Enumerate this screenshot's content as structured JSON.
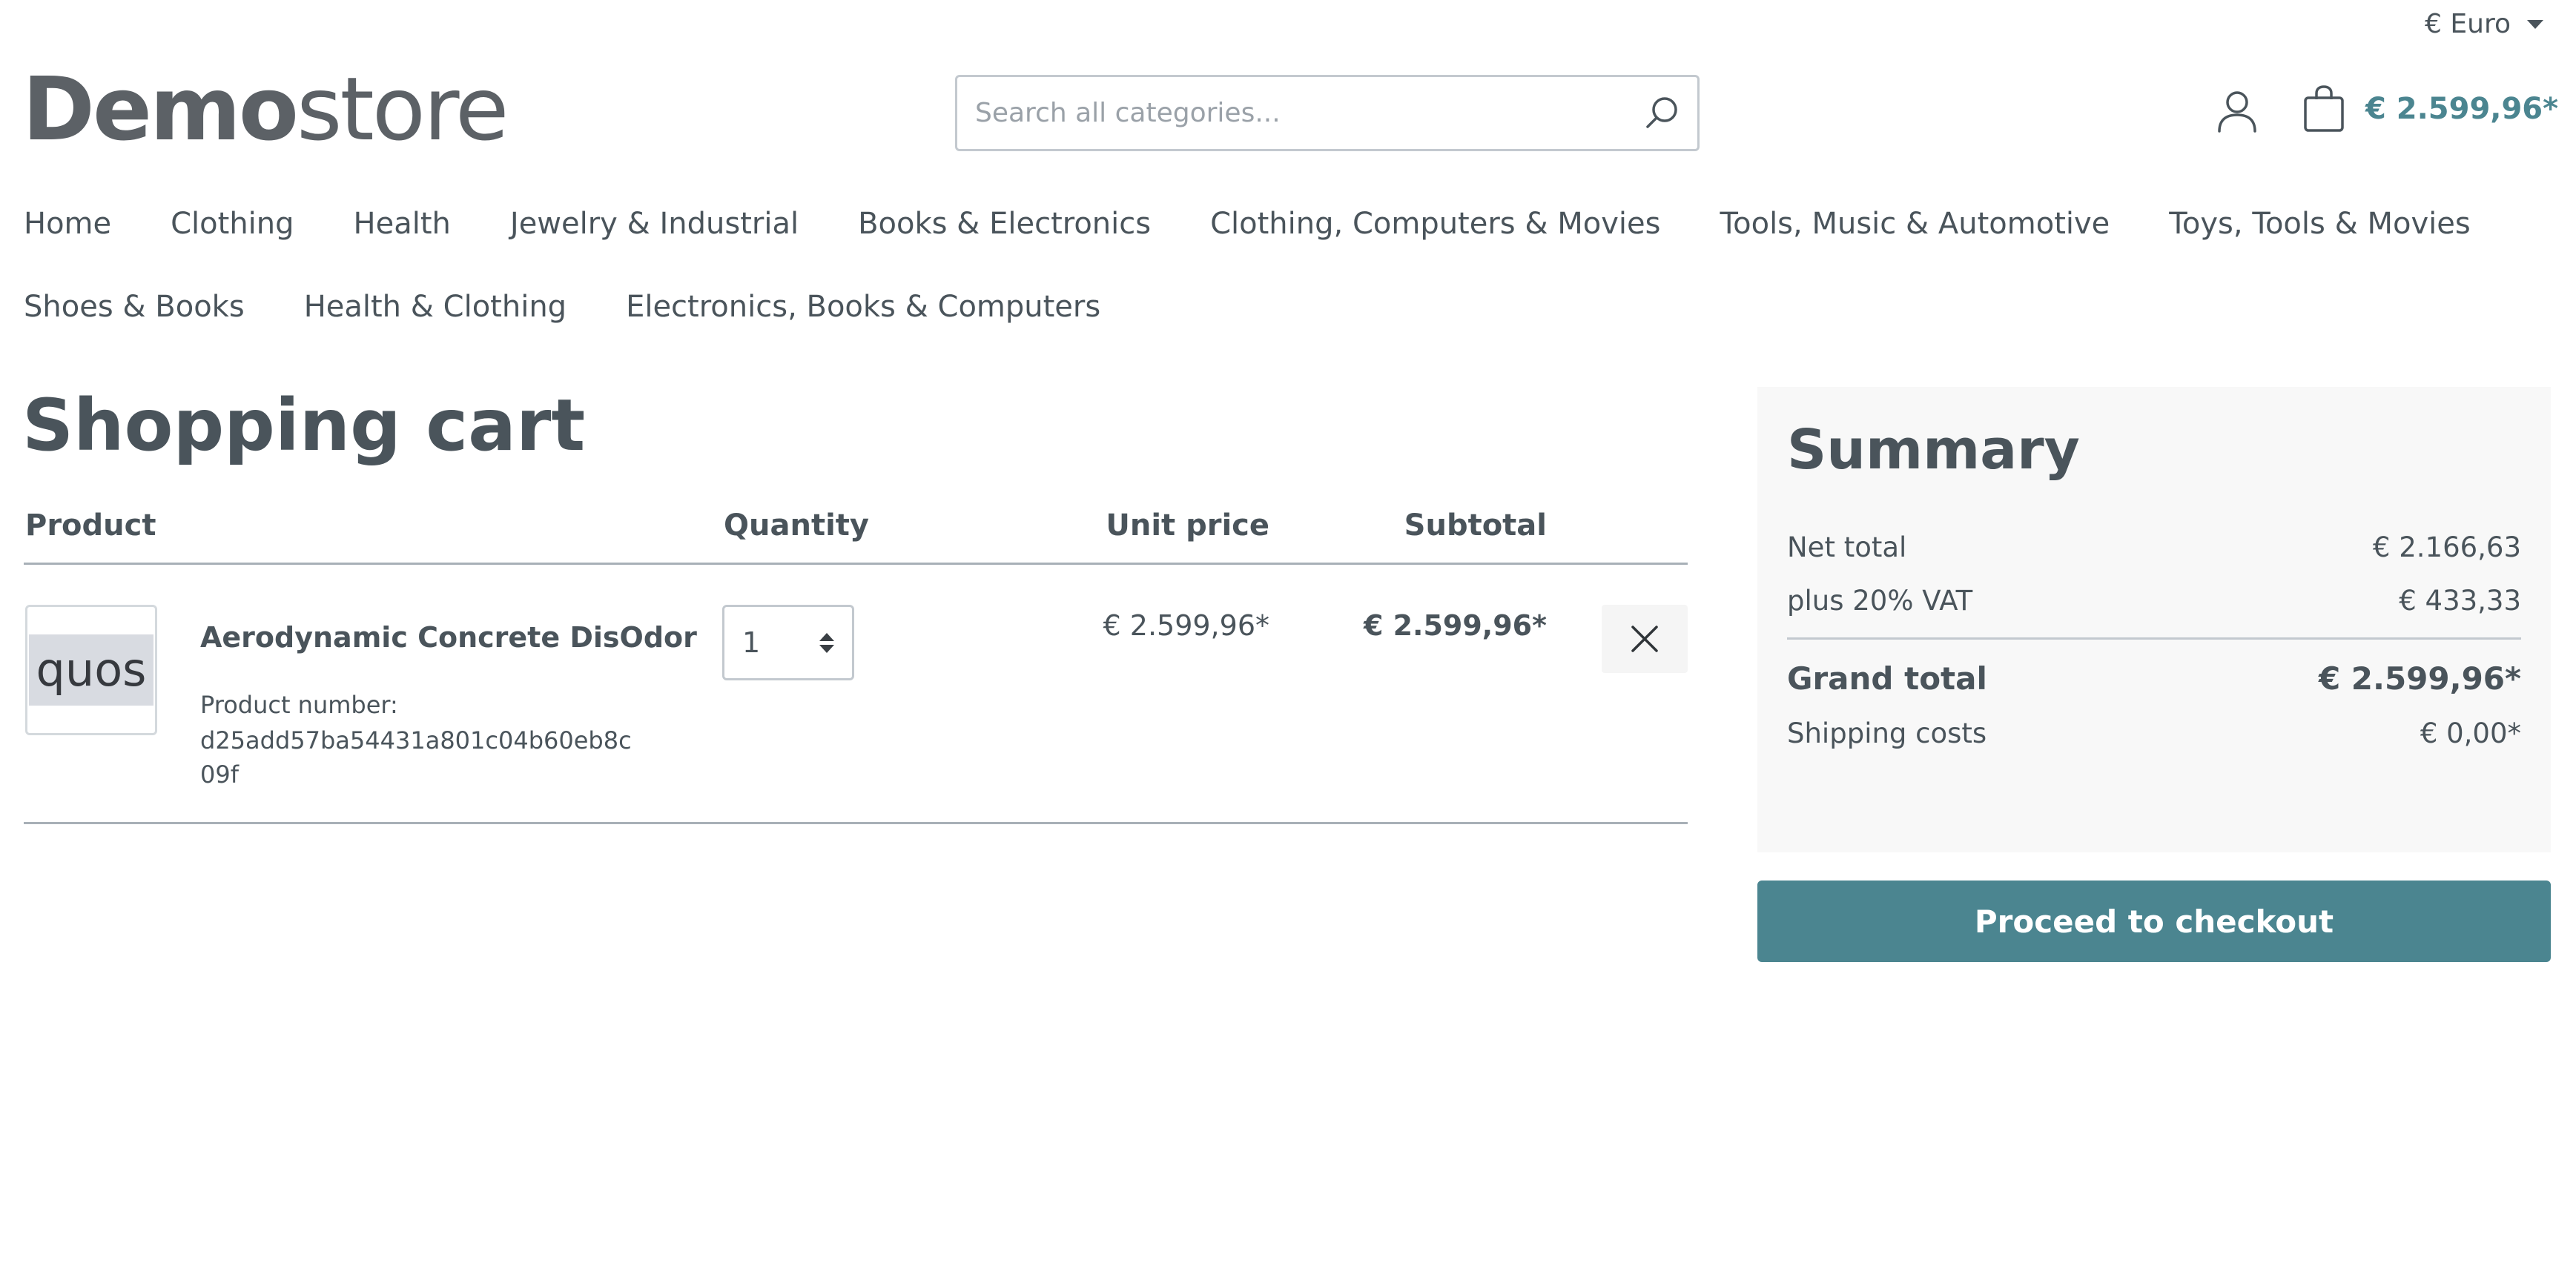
{
  "currency": {
    "label": "€ Euro"
  },
  "header": {
    "logo_strong": "Demo",
    "logo_light": "store",
    "search_placeholder": "Search all categories...",
    "cart_total": "€ 2.599,96*"
  },
  "nav": {
    "items": [
      "Home",
      "Clothing",
      "Health",
      "Jewelry & Industrial",
      "Books & Electronics",
      "Clothing, Computers & Movies",
      "Tools, Music & Automotive",
      "Toys, Tools & Movies",
      "Shoes & Books",
      "Health & Clothing",
      "Electronics, Books & Computers"
    ]
  },
  "page": {
    "title": "Shopping cart"
  },
  "cart": {
    "headers": {
      "product": "Product",
      "quantity": "Quantity",
      "unit_price": "Unit price",
      "subtotal": "Subtotal"
    },
    "items": [
      {
        "thumb_text": "quos",
        "name": "Aerodynamic Concrete DisOdor",
        "number_label": "Product number:",
        "number": "d25add57ba54431a801c04b60eb8c09f",
        "quantity": "1",
        "unit_price": "€ 2.599,96*",
        "subtotal": "€ 2.599,96*"
      }
    ]
  },
  "summary": {
    "title": "Summary",
    "net_total_label": "Net total",
    "net_total": "€ 2.166,63",
    "vat_label": "plus 20% VAT",
    "vat": "€ 433,33",
    "grand_total_label": "Grand total",
    "grand_total": "€ 2.599,96*",
    "shipping_label": "Shipping costs",
    "shipping": "€ 0,00*",
    "checkout_label": "Proceed to checkout"
  },
  "colors": {
    "accent": "#4b8590",
    "text": "#4a545b",
    "summary_bg": "#f8f8f8"
  },
  "icons": {
    "search": "search-icon",
    "account": "account-icon",
    "cart": "shopping-bag-icon",
    "remove": "close-icon"
  }
}
